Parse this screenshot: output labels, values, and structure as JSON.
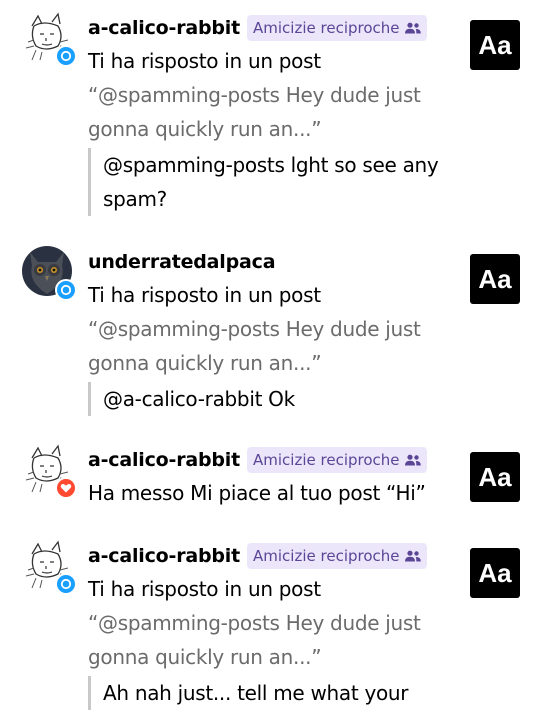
{
  "notifications": [
    {
      "username": "a-calico-rabbit",
      "mutual_label": "Amicizie reciproche",
      "badge": "reply",
      "avatar": "sketch-avatar",
      "action": "Ti ha risposto in un post",
      "excerpt": "“@spamming-posts Hey dude just gonna quickly run an...”",
      "reply": "@spamming-posts lght so see any spam?",
      "thumb": "Aa"
    },
    {
      "username": "underratedalpaca",
      "badge": "reply",
      "avatar": "owl-avatar",
      "action": "Ti ha risposto in un post",
      "excerpt": "“@spamming-posts Hey dude just gonna quickly run an...”",
      "reply": "@a-calico-rabbit Ok",
      "thumb": "Aa"
    },
    {
      "username": "a-calico-rabbit",
      "mutual_label": "Amicizie reciproche",
      "badge": "like",
      "avatar": "sketch-avatar",
      "action": "Ha messo Mi piace al tuo post “Hi”",
      "thumb": "Aa"
    },
    {
      "username": "a-calico-rabbit",
      "mutual_label": "Amicizie reciproche",
      "badge": "reply",
      "avatar": "sketch-avatar",
      "action": "Ti ha risposto in un post",
      "excerpt": "“@spamming-posts Hey dude just gonna quickly run an...”",
      "reply": "Ah nah just... tell me what your",
      "thumb": "Aa"
    }
  ],
  "colors": {
    "reply_badge": "#199fff",
    "like_badge": "#ff4930",
    "mutual_bg": "#ece6fa",
    "mutual_text": "#5b4596"
  }
}
